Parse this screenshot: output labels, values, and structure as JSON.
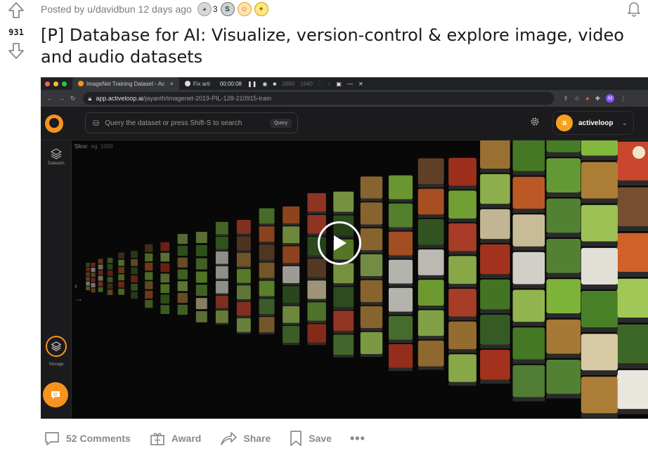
{
  "post": {
    "score": "931",
    "posted_by": "Posted by u/davidbun 12 days ago",
    "award_count": "3",
    "title": "[P] Database for AI: Visualize, version-control & explore image, video and audio datasets"
  },
  "video": {
    "browser": {
      "active_tab": "ImageNet Training Dataset - Ac",
      "second_tab": "Fix arti",
      "timer": "00:00:08",
      "resolution_w": "2880",
      "resolution_h": "1640",
      "url_host": "app.activeloop.ai",
      "url_path": "/jayanth/imagenet-2019-PIL-128-210915-train",
      "profile_initial": "M"
    },
    "app": {
      "search_placeholder": "Query the dataset or press Shift-S to search",
      "query_button": "Query",
      "account_initial": "a",
      "account_name": "activeloop",
      "datasets_label": "Datasets",
      "storage_label": "Storage",
      "slice_label": "Slice:",
      "slice_placeholder": "eg. 1000"
    }
  },
  "actions": {
    "comments": "52 Comments",
    "award": "Award",
    "share": "Share",
    "save": "Save",
    "more": "•••"
  },
  "colors": {
    "accent_orange": "#f7931e",
    "text_muted": "#787c7e",
    "action_gray": "#878a8c"
  }
}
